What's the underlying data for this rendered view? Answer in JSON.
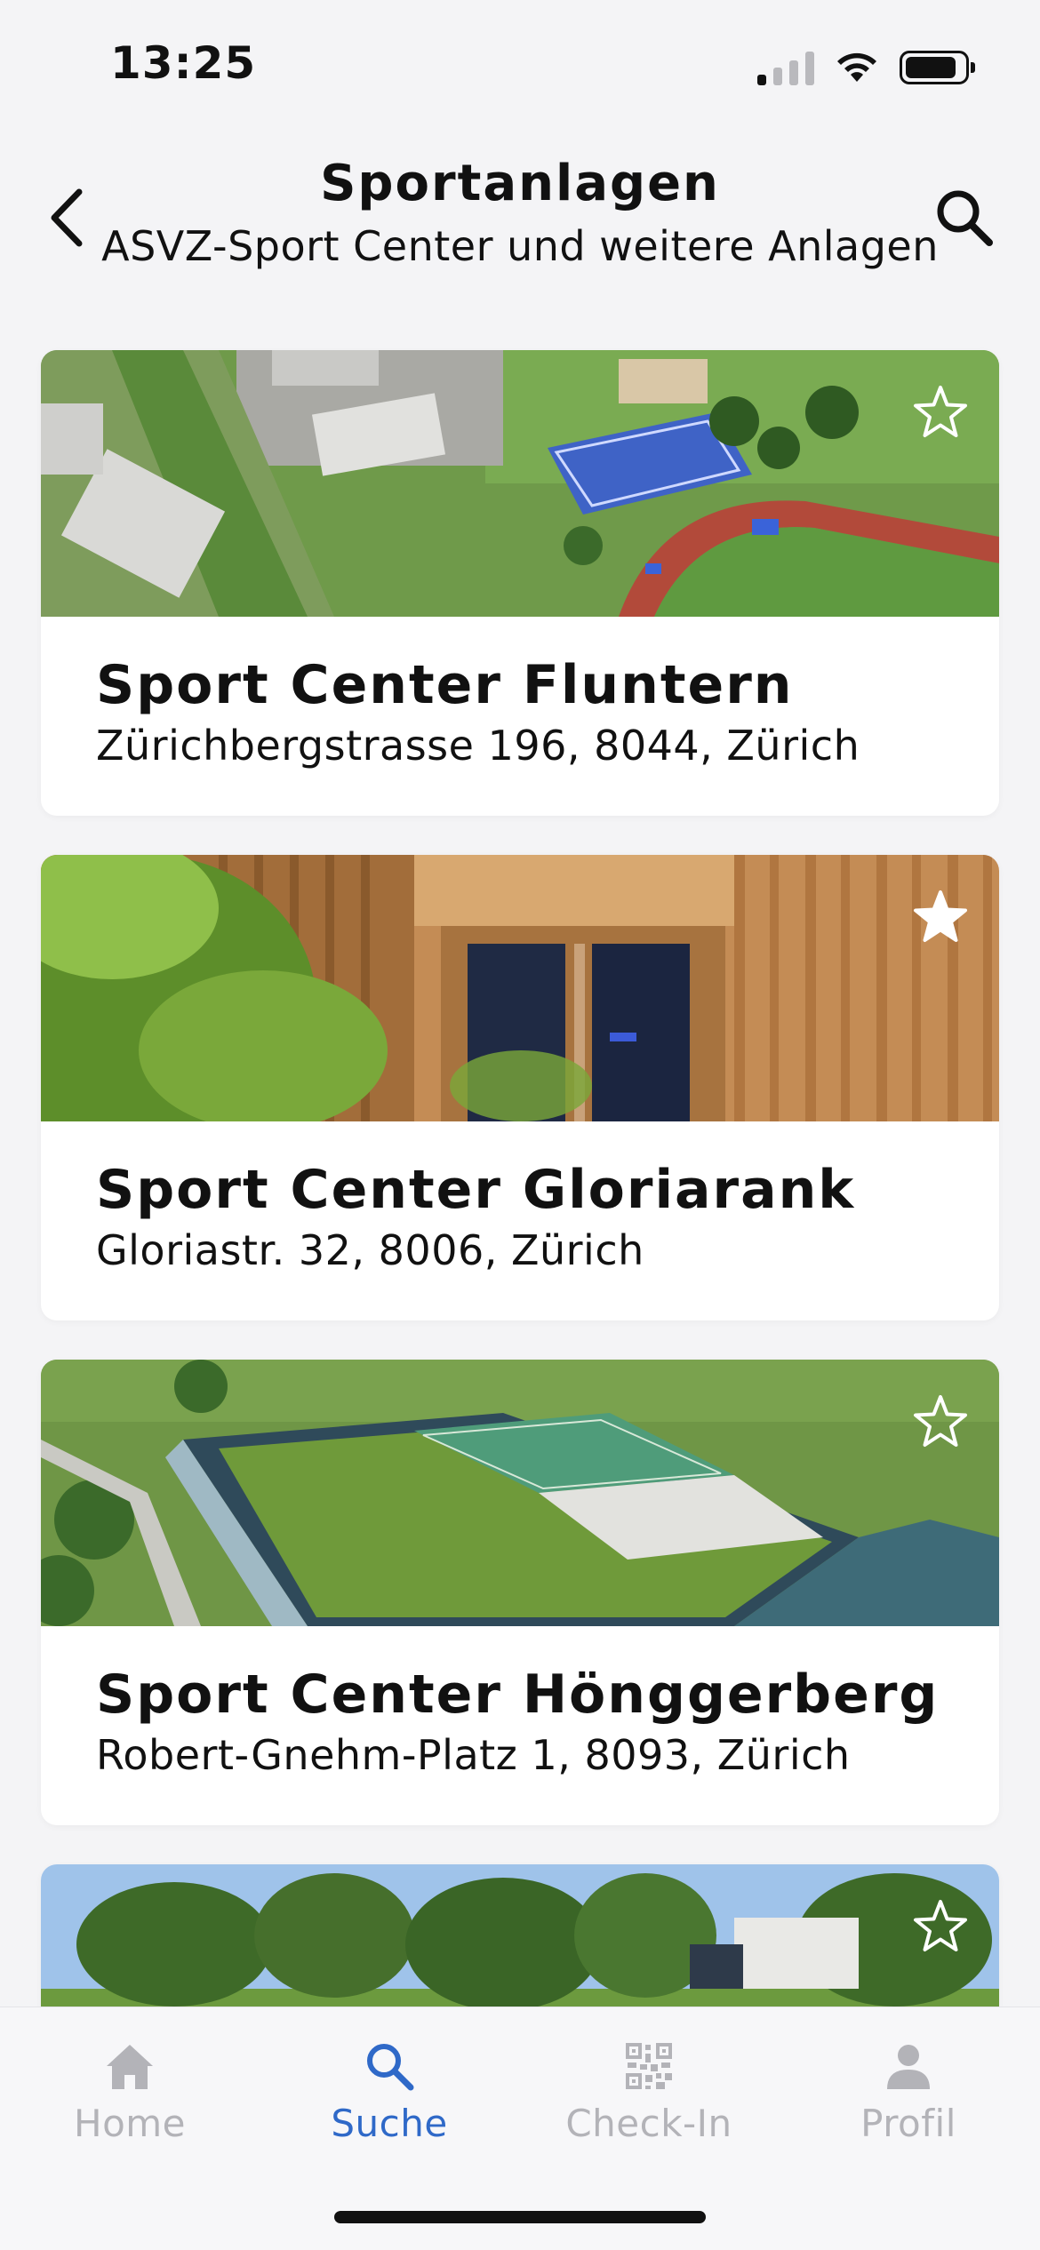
{
  "status_bar": {
    "time": "13:25",
    "icons": [
      "cellular-signal-icon",
      "wifi-icon",
      "battery-icon"
    ]
  },
  "header": {
    "title": "Sportanlagen",
    "subtitle": "ASVZ-Sport Center und weitere Anlagen",
    "back_icon": "chevron-left-icon",
    "search_icon": "search-icon"
  },
  "facilities": [
    {
      "name": "Sport Center Fluntern",
      "address": "Zürichbergstrasse 196, 8044, Zürich",
      "favorite": false
    },
    {
      "name": "Sport Center Gloriarank",
      "address": "Gloriastr. 32, 8006, Zürich",
      "favorite": true
    },
    {
      "name": "Sport Center Hönggerberg",
      "address": "Robert-Gnehm-Platz 1, 8093, Zürich",
      "favorite": false
    },
    {
      "name": "",
      "address": "",
      "favorite": false
    }
  ],
  "tab_bar": {
    "tabs": [
      {
        "label": "Home",
        "icon": "house-icon",
        "active": false
      },
      {
        "label": "Suche",
        "icon": "search-icon",
        "active": true
      },
      {
        "label": "Check-In",
        "icon": "qr-code-icon",
        "active": false
      },
      {
        "label": "Profil",
        "icon": "person-icon",
        "active": false
      }
    ]
  },
  "colors": {
    "accent": "#2f69c8",
    "inactive_tab": "#b3b3b8",
    "background": "#f4f4f6",
    "card": "#ffffff",
    "text": "#111111"
  }
}
